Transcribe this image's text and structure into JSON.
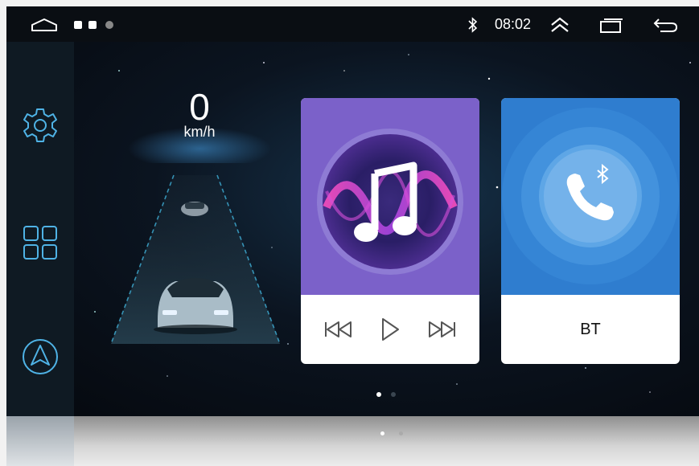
{
  "status_bar": {
    "time": "08:02",
    "icons": [
      "home-icon",
      "notification-dots",
      "bluetooth-icon",
      "chevron-up-double-icon",
      "recent-apps-icon",
      "back-icon"
    ]
  },
  "sidebar": {
    "items": [
      {
        "name": "settings",
        "icon": "gear-icon"
      },
      {
        "name": "apps",
        "icon": "apps-grid-icon"
      },
      {
        "name": "navigation",
        "icon": "navigation-arrow-icon"
      }
    ]
  },
  "speedometer": {
    "value": "0",
    "unit": "km/h"
  },
  "music_card": {
    "icon": "music-note-icon",
    "controls": [
      "previous-icon",
      "play-icon",
      "next-icon"
    ]
  },
  "bt_card": {
    "icon": "bluetooth-phone-icon",
    "label": "BT"
  },
  "pager": {
    "pages": 2,
    "current": 1
  },
  "colors": {
    "accent_cyan": "#4fb3e6",
    "music_bg": "#7b61c9",
    "bt_bg": "#2f7dcf"
  }
}
